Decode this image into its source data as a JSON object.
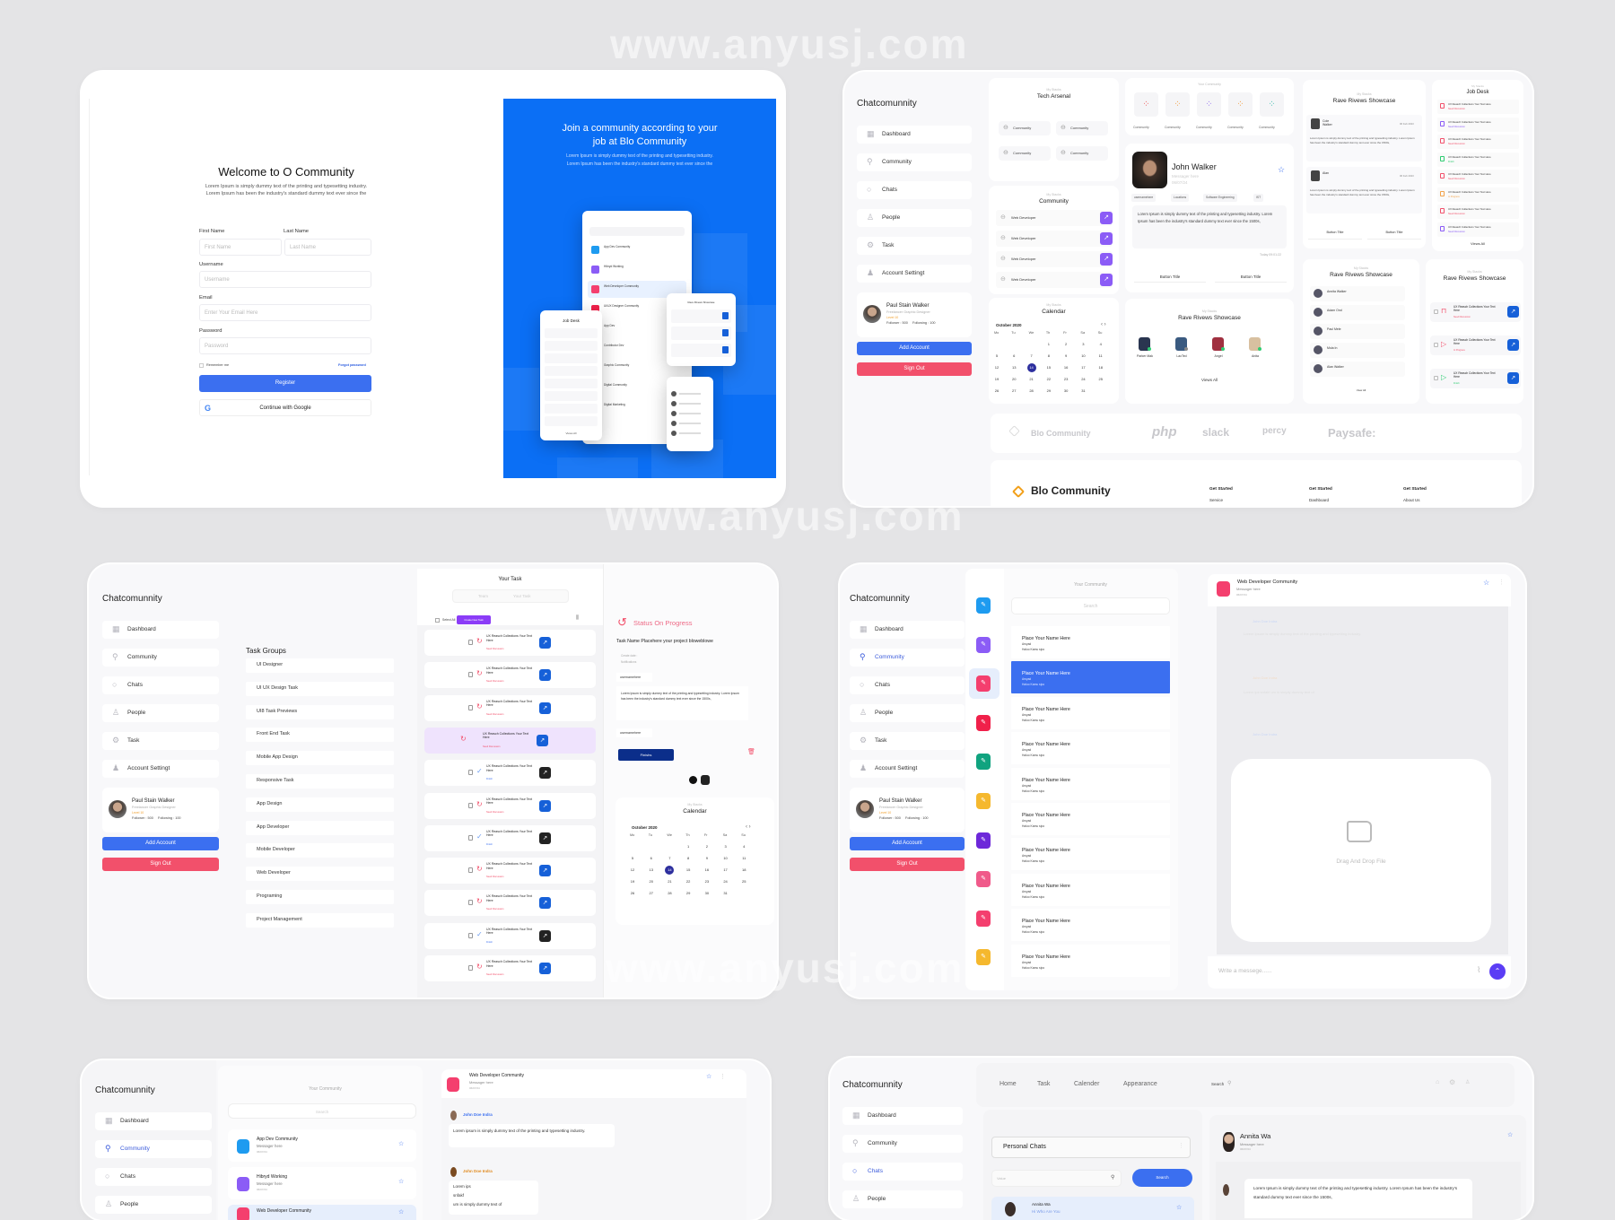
{
  "watermark": "www.anyusj.com",
  "brand": "Chatcomunnity",
  "colors": {
    "primary": "#3b6ff0",
    "danger": "#f2506b",
    "hero": "#0b6ff5",
    "purple": "#8b5cf6",
    "navy": "#0b2e8a"
  },
  "sidebar": {
    "items": [
      {
        "label": "Dashboard",
        "icon": "grid-icon"
      },
      {
        "label": "Community",
        "icon": "search-icon"
      },
      {
        "label": "Chats",
        "icon": "chat-icon"
      },
      {
        "label": "People",
        "icon": "user-icon"
      },
      {
        "label": "Task",
        "icon": "task-icon"
      },
      {
        "label": "Account Settingt",
        "icon": "account-icon"
      }
    ],
    "profile": {
      "name": "Paul Stain Walker",
      "role": "Freelancer Graphic Designer",
      "level": "Level 10",
      "followers": "Follower : 500",
      "following": "Following : 100"
    },
    "add_account": "Add Account",
    "sign_out": "Sign Out"
  },
  "register": {
    "title": "Welcome to O Community",
    "subtitle1": "Lorem Ipsum is simply dummy text of the printing and typesetting industry.",
    "subtitle2": "Lorem Ipsum has been the industry's standard dummy text ever since the",
    "first_name_label": "First Name",
    "first_name_placeholder": "First Name",
    "last_name_label": "Last Name",
    "last_name_placeholder": "Last Name",
    "username_label": "Username",
    "username_placeholder": "Username",
    "email_label": "Email",
    "email_placeholder": "Enter Your Email Here",
    "password_label": "Password",
    "password_placeholder": "Password",
    "remember": "Remember me",
    "forgot": "Forgot password",
    "register_button": "Register",
    "google_button": "Continue with Google"
  },
  "hero": {
    "title1": "Join a community according to your",
    "title2": "job at Blo Community",
    "desc1": "Lorem Ipsum is simply dummy text of the printing and typesetting industry.",
    "desc2": "Lorem Ipsum has been the industry's standard dummy text ever since the",
    "mock_communities": [
      "App Dev Community",
      "Hibryd Working",
      "Web Developer Community",
      "UI/UX Designer Community",
      "App Dev",
      "Contributor Dev",
      "Graphic Community",
      "Digital Community",
      "Digital Marketing"
    ],
    "job_desk": "Job Desk",
    "views_all": "Views All",
    "showcase": "Rave Rivews Showcase"
  },
  "stacks_label": "My Stacks",
  "your_community": "Your Community",
  "tech_arsenal": {
    "title": "Tech Arsenal",
    "chips": [
      "Community",
      "Community",
      "Community",
      "Community"
    ]
  },
  "icon_tiles": {
    "labels": [
      "Community",
      "Community",
      "Community",
      "Community",
      "Community"
    ],
    "colors": [
      "#f06a6a",
      "#f2a24a",
      "#9b7cf0",
      "#f2a24a",
      "#4cc3b5"
    ]
  },
  "community_card": {
    "title": "Community",
    "rows": [
      "Web Developer",
      "Web Developer",
      "Web Developer",
      "Web Developer"
    ]
  },
  "calendar": {
    "title": "Calendar",
    "month": "October 2020",
    "weekdays": [
      "Mo",
      "Tu",
      "We",
      "Th",
      "Fr",
      "Sa",
      "Su"
    ],
    "weeks": [
      [
        null,
        null,
        null,
        1,
        2,
        3,
        4
      ],
      [
        5,
        6,
        7,
        8,
        9,
        10,
        11
      ],
      [
        12,
        13,
        14,
        15,
        16,
        17,
        18
      ],
      [
        19,
        20,
        21,
        22,
        23,
        24,
        25
      ],
      [
        26,
        27,
        28,
        29,
        30,
        31,
        null
      ]
    ],
    "selected": 14
  },
  "profile_card": {
    "name": "John Walker",
    "message": "Messager here",
    "date": "06/07/24",
    "tags": [
      "usernamehere",
      "Locations",
      "Software Engineering",
      "IST"
    ],
    "bio": "Lorem Ipsum is simply dummy text of the printing and typesetting industry. Lorem Ipsum has been the industry's standard dummy text ever since the 1500s,",
    "time": "Today 09:01:22",
    "buttons": [
      "Button Title",
      "Button Title"
    ]
  },
  "showcase_avatars": {
    "title": "Rave Rivews Showcase",
    "people": [
      "Parker Mak",
      "LacTed",
      "Angel",
      "Anita"
    ],
    "views_all": "Views All"
  },
  "reviews_card": {
    "title": "Rave Rivews Showcase",
    "reviews": [
      {
        "name": "Cole Walker",
        "date": "06 Feb 2023",
        "text": "Lorem Ipsum is simply dummy text of the printing and typesetting industry. Lorem Ipsum has been the industry's standard dummy text ever since the 1500s,"
      },
      {
        "name": "Alan",
        "date": "06 Feb 2023",
        "text": "Lorem Ipsum is simply dummy text of the printing and typesetting industry. Lorem Ipsum has been the industry's standard dummy text ever since the 1500s,"
      }
    ],
    "buttons": [
      "Button Title",
      "Button Title"
    ]
  },
  "job_desk": {
    "title": "Job Desk",
    "item": "UX Reasch Collections Your Text Here",
    "tags": [
      "Need Discussion",
      "Need Discussion",
      "Need Discussion",
      "Finish",
      "Need Discussion",
      "In Progress",
      "Need Discussion",
      "Need Discussion"
    ],
    "views_all": "Views All"
  },
  "people_list": {
    "title": "Rave Rivews Showcase",
    "people": [
      "Annita Walker",
      "Adam Ond",
      "Paul Mele",
      "Mola In",
      "Alan Walker"
    ],
    "view_all": "View All"
  },
  "task_showcase": {
    "title": "Rave Rivews Showcase",
    "items": [
      {
        "text": "UX Reasch Collections Your Text Here",
        "tag": "Need Discussion",
        "color": "#f2506b"
      },
      {
        "text": "UX Reasch Collections Your Text Here",
        "tag": "In Progress",
        "color": "#f2506b"
      },
      {
        "text": "UX Reasch Collections Your Text Here",
        "tag": "Finish",
        "color": "#2ecc71"
      }
    ]
  },
  "logos": [
    "Blo Community",
    "php",
    "slack",
    "percy",
    "Paysafe:"
  ],
  "footer": {
    "brand": "Blo Community",
    "columns": [
      {
        "head": "Get Started",
        "item": "Service"
      },
      {
        "head": "Get Started",
        "item": "Dashboard"
      },
      {
        "head": "Get Started",
        "item": "About Us"
      }
    ]
  },
  "tasks": {
    "title": "Your Task",
    "tabs": [
      "Team",
      "Your Task"
    ],
    "select_all": "Select All",
    "create": "Create New Task",
    "groups_title": "Task Groups",
    "groups": [
      "UI Designer",
      "UI UX Design Task",
      "UI8 Task Previews",
      "Front End Task",
      "Mobile App Design",
      "Responsive Task",
      "App Design",
      "App Developer",
      "Mobile Developer",
      "Web Developer",
      "Programing",
      "Project Management"
    ],
    "row_text": "UX Reasch Collections Your Text Here",
    "rows": [
      {
        "state": "progress",
        "tag": "Need Discussion"
      },
      {
        "state": "progress",
        "tag": "Need Discussion"
      },
      {
        "state": "progress",
        "tag": "Need Discussion"
      },
      {
        "state": "active",
        "tag": "Need Discussion"
      },
      {
        "state": "done",
        "tag": "Finish"
      },
      {
        "state": "progress",
        "tag": "Need Discussion"
      },
      {
        "state": "done",
        "tag": "Finish"
      },
      {
        "state": "progress",
        "tag": "Need Discussion"
      },
      {
        "state": "progress",
        "tag": "Need Discussion"
      },
      {
        "state": "done",
        "tag": "Finish"
      },
      {
        "state": "progress",
        "tag": "Need Discussion"
      }
    ],
    "detail": {
      "status": "Status On Progress",
      "name": "Task Name Placehere your project bloweblowe",
      "create_date": "Create date :",
      "notifications": "Notifications",
      "user": "usernamehere",
      "desc": "Lorem Ipsum is simply dummy text of the printing and typesetting industry. Lorem Ipsum has been the industry's standard dummy text ever since the 1500s,",
      "finish": "Finishs"
    }
  },
  "community_chat": {
    "search_placeholder": "Search",
    "icon_colors": [
      "#1e9bf0",
      "#8b5cf6",
      "#f43f6e",
      "#f0204a",
      "#10a37f",
      "#f5b82e",
      "#6d28d9",
      "#f05a8a",
      "#f43f6e",
      "#f5b82e"
    ],
    "item": {
      "name": "Place Your Name Here",
      "sub": "Arsyad",
      "msg": "Haloo Kamu sipo"
    },
    "item_count_label": "10",
    "chat_title": "Web Developer Community",
    "chat_sub": "Messager here",
    "chat_date": "06/07/24",
    "sender": "John Doe Indra",
    "faded_msg1": "Lorem Ipsum is simply dummy text of the printing and typesetting industry.",
    "faded_msg2": "Lorem ips snfakf um is simply dummy text of",
    "drop": "Drag And Drop File",
    "input_placeholder": "Write a messege......"
  },
  "community_list": {
    "items": [
      {
        "name": "App Dev Community",
        "sub": "Messager here",
        "date": "06/07/24",
        "color": "#1e9bf0"
      },
      {
        "name": "Hibryd Working",
        "sub": "Messager here",
        "date": "06/07/24",
        "color": "#8b5cf6"
      },
      {
        "name": "Web Developer Community",
        "sub": "Messager here",
        "date": "06/07/24",
        "color": "#f43f6e"
      }
    ],
    "msg1": "Lorem ipsum is simply dummy text of the printing and typesetting industry.",
    "msg2a": "Lorem ips",
    "msg2b": "snfakf",
    "msg2c": "um is simply dummy text of"
  },
  "personal": {
    "nav": [
      "Home",
      "Task",
      "Calender",
      "Appearance"
    ],
    "search_label": "Search",
    "title": "Personal Chats",
    "value_placeholder": "Value",
    "search_button": "Search",
    "contact": {
      "name": "Annita Wa",
      "msg": "Hi Who Are You"
    },
    "chat_name": "Annita Wa",
    "chat_sub": "Messager here",
    "chat_date": "06/07/24",
    "bubble": "Lorem Ipsum is simply dummy text of the printing and typesetting industry. Lorem Ipsum has been the industry's standard dummy text ever since the 1500s,"
  }
}
